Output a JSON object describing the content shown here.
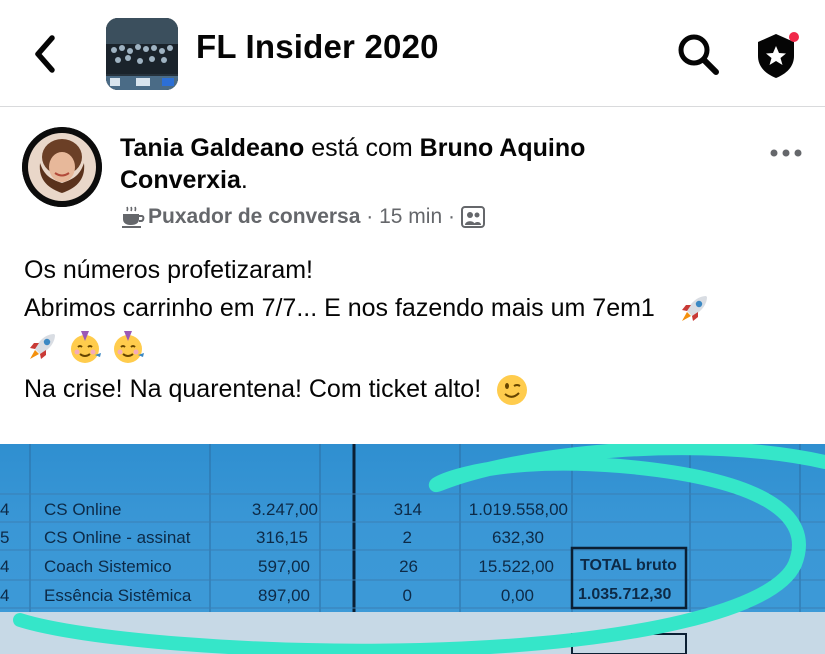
{
  "header": {
    "title": "FL Insider 2020",
    "icons": [
      "back-chevron-icon",
      "search-icon",
      "admin-shield-icon"
    ]
  },
  "post": {
    "author": "Tania Galdeano",
    "connector": "está com",
    "with": "Bruno Aquino Conversia",
    "with_first": "Bruno Aquino",
    "with_second": "Converxia",
    "badge": "Puxador de conversa",
    "time": "15 min",
    "lines": [
      "Os números profetizaram!",
      "Abrimos carrinho em 7/7... E nos fazendo mais um 7em1",
      "Na crise! Na quarentena! Com ticket alto!"
    ]
  },
  "spreadsheet": {
    "rows": [
      {
        "idx": "4",
        "name": "CS Online",
        "price": "3.247,00",
        "qty": "314",
        "total": "1.019.558,00",
        "extra": ""
      },
      {
        "idx": "5",
        "name": "CS Online - assinat",
        "price": "316,15",
        "qty": "2",
        "total": "632,30",
        "extra": ""
      },
      {
        "idx": "4",
        "name": "Coach Sistemico",
        "price": "597,00",
        "qty": "26",
        "total": "15.522,00",
        "extra": "TOTAL bruto"
      },
      {
        "idx": "4",
        "name": "Essência Sistêmica",
        "price": "897,00",
        "qty": "0",
        "total": "0,00",
        "extra": "1.035.712,30"
      }
    ]
  }
}
